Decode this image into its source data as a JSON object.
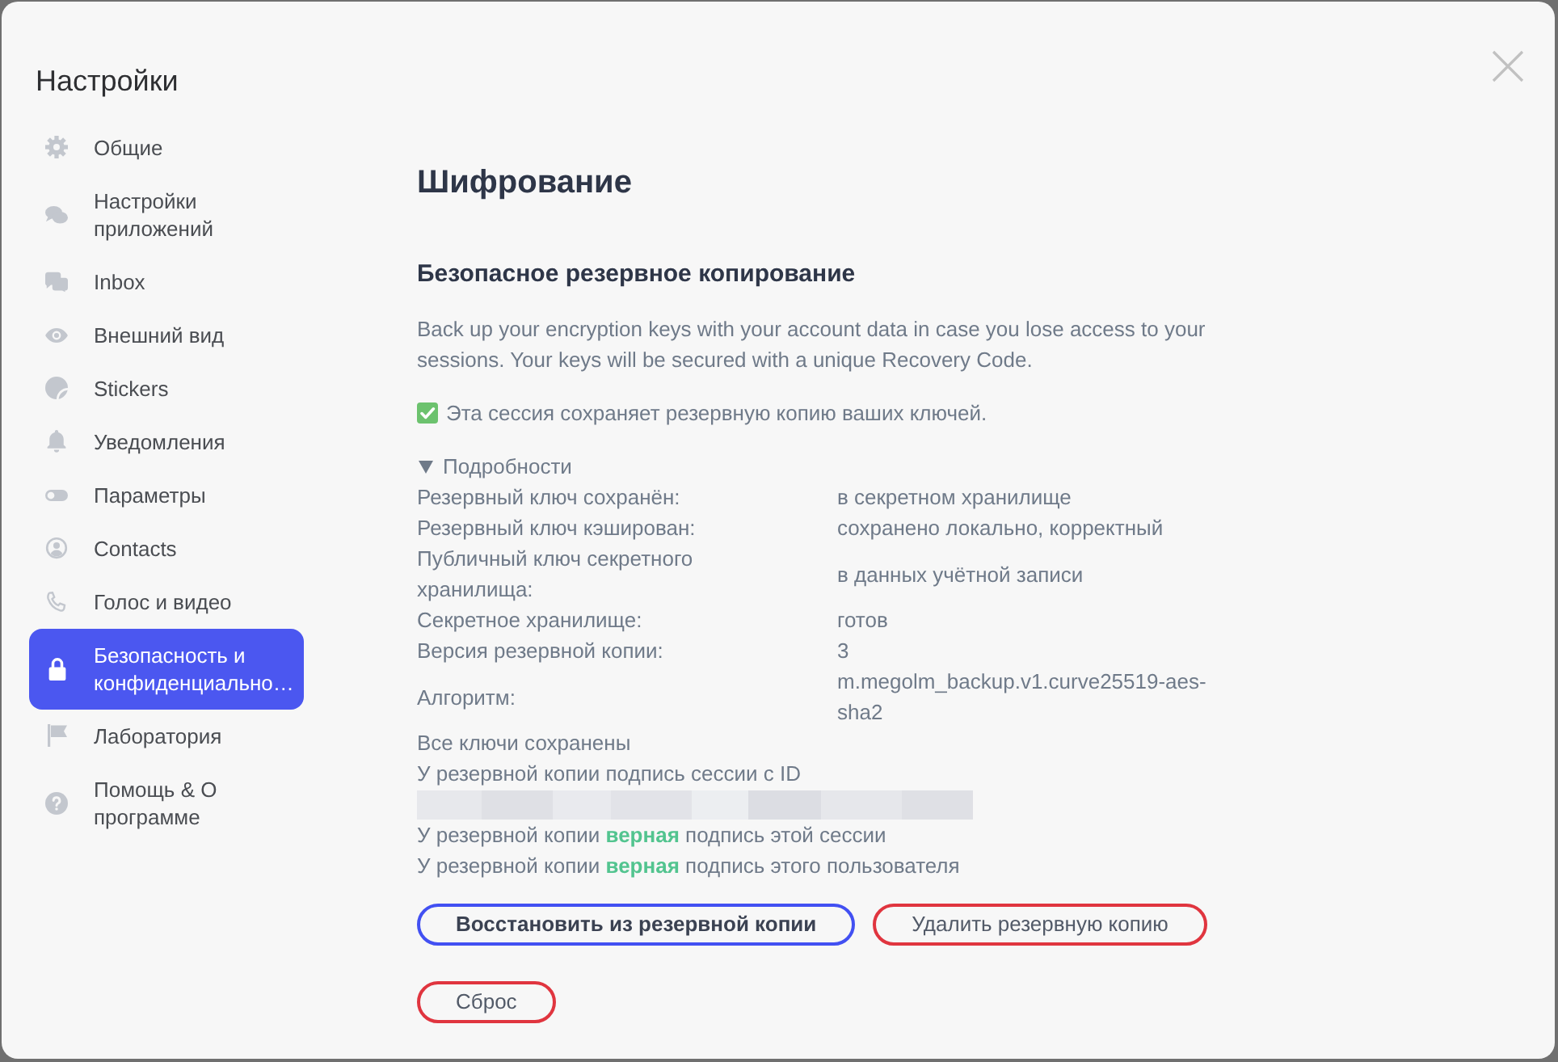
{
  "dialog": {
    "title": "Настройки"
  },
  "sidebar": {
    "items": [
      {
        "label": "Общие",
        "selected": false
      },
      {
        "label": "Настройки приложений",
        "selected": false
      },
      {
        "label": "Inbox",
        "selected": false
      },
      {
        "label": "Внешний вид",
        "selected": false
      },
      {
        "label": "Stickers",
        "selected": false
      },
      {
        "label": "Уведомления",
        "selected": false
      },
      {
        "label": "Параметры",
        "selected": false
      },
      {
        "label": "Contacts",
        "selected": false
      },
      {
        "label": "Голос и видео",
        "selected": false
      },
      {
        "label": "Безопасность и конфиденциально…",
        "selected": true
      },
      {
        "label": "Лаборатория",
        "selected": false
      },
      {
        "label": "Помощь & О программе",
        "selected": false
      }
    ]
  },
  "page": {
    "title": "Шифрование"
  },
  "secure_backup": {
    "title": "Безопасное резервное копирование",
    "description": "Back up your encryption keys with your account data in case you lose access to your sessions. Your keys will be secured with a unique Recovery Code.",
    "status": "Эта сессия сохраняет резервную копию ваших ключей.",
    "details": {
      "summary": "Подробности",
      "expanded": true,
      "fields": [
        {
          "label": "Резервный ключ сохранён:",
          "value": "в секретном хранилище"
        },
        {
          "label": "Резервный ключ кэширован:",
          "value": "сохранено локально, корректный"
        },
        {
          "label": "Публичный ключ секретного хранилища:",
          "value": "в данных учётной записи"
        },
        {
          "label": "Секретное хранилище:",
          "value": "готов"
        },
        {
          "label": "Версия резервной копии:",
          "value": "3"
        },
        {
          "label": "Алгоритм:",
          "value": "m.megolm_backup.v1.curve25519-aes-sha2"
        }
      ],
      "notes": [
        "Все ключи сохранены",
        "У резервной копии подпись сессии с ID"
      ],
      "session_id_redacted": true,
      "signatures": [
        "У резервной копии **верная** подпись этой сессии",
        "У резервной копии **верная** подпись этого пользователя"
      ]
    },
    "button_rows": [
      [
        {
          "label": "Восстановить из резервной копии",
          "kind": "primary"
        },
        {
          "label": "Удалить резервную копию",
          "kind": "danger"
        }
      ],
      [
        {
          "label": "Сброс",
          "kind": "danger"
        }
      ]
    ]
  }
}
